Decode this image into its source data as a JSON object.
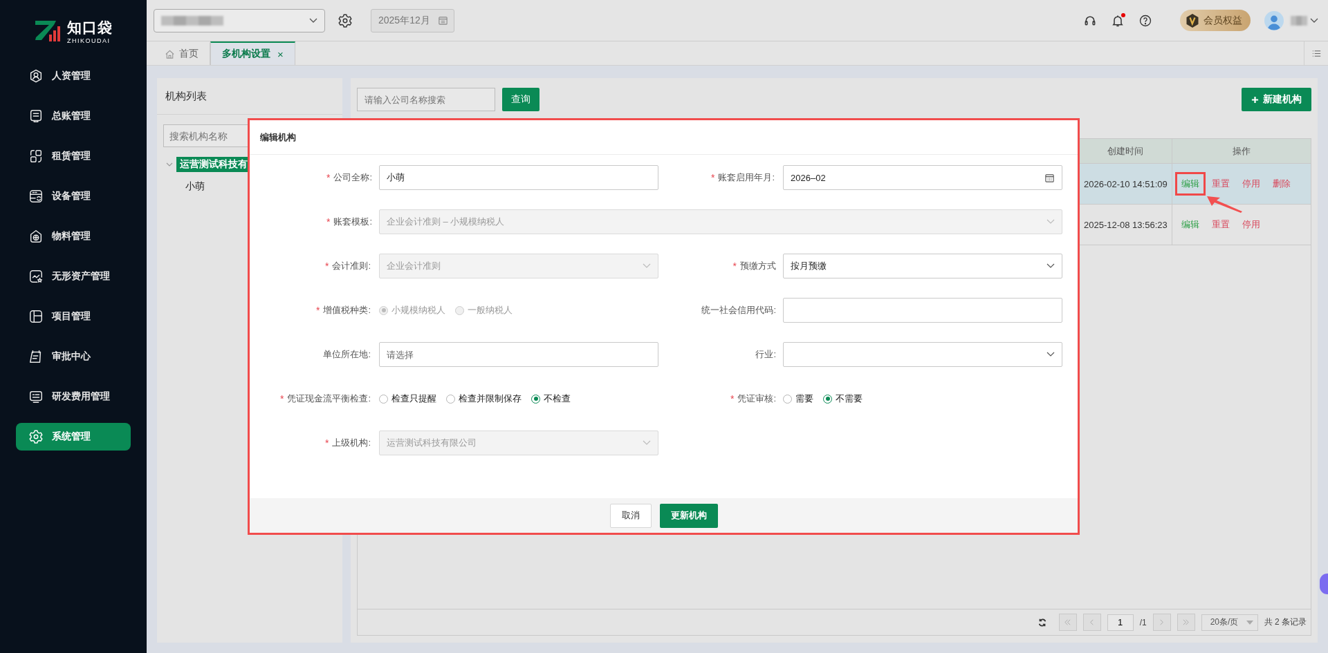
{
  "sidebar": {
    "logo": {
      "name": "知口袋",
      "sub": "ZHIKOUDAI"
    },
    "items": [
      {
        "label": "人资管理",
        "kind": "person",
        "selected": false
      },
      {
        "label": "总账管理",
        "kind": "ledger",
        "selected": false
      },
      {
        "label": "租赁管理",
        "kind": "lease",
        "selected": false
      },
      {
        "label": "设备管理",
        "kind": "device",
        "selected": false
      },
      {
        "label": "物料管理",
        "kind": "material",
        "selected": false
      },
      {
        "label": "无形资产管理",
        "kind": "asset",
        "selected": false
      },
      {
        "label": "项目管理",
        "kind": "project",
        "selected": false
      },
      {
        "label": "审批中心",
        "kind": "approval",
        "selected": false
      },
      {
        "label": "研发费用管理",
        "kind": "rd",
        "selected": false
      },
      {
        "label": "系统管理",
        "kind": "gear",
        "selected": true
      }
    ]
  },
  "topbar": {
    "period": "2025年12月",
    "notification_unread": true,
    "member": "会员权益"
  },
  "tabs": [
    {
      "label": "首页",
      "kind": "home",
      "selected": false
    },
    {
      "label": "多机构设置",
      "kind": "page",
      "selected": true,
      "close": "×"
    }
  ],
  "org_panel": {
    "title": "机构列表",
    "search_placeholder": "搜索机构名称",
    "tree": [
      {
        "label": "运营测试科技有",
        "selected": true,
        "expanded": true,
        "children": [
          {
            "label": "小萌",
            "selected": false
          }
        ]
      }
    ]
  },
  "list_panel": {
    "search_placeholder": "请输入公司名称搜索",
    "query_button": "查询",
    "new_button": "新建机构",
    "table": {
      "columns": [
        "创建时间",
        "操作"
      ],
      "rows": [
        {
          "selected": true,
          "created": "2026-02-10 14:51:09",
          "actions": [
            {
              "label": "编辑",
              "kind": "edit",
              "highlighted": true
            },
            {
              "label": "重置",
              "kind": "danger",
              "highlighted": false
            },
            {
              "label": "停用",
              "kind": "danger",
              "highlighted": false
            },
            {
              "label": "删除",
              "kind": "danger",
              "highlighted": false
            }
          ]
        },
        {
          "selected": false,
          "created": "2025-12-08 13:56:23",
          "actions": [
            {
              "label": "编辑",
              "kind": "edit",
              "highlighted": false
            },
            {
              "label": "重置",
              "kind": "danger",
              "highlighted": false
            },
            {
              "label": "停用",
              "kind": "danger",
              "highlighted": false
            }
          ]
        }
      ]
    },
    "pagination": {
      "page": "1",
      "total_pages": "/1",
      "page_size": "20条/页",
      "summary": "共 2 条记录"
    }
  },
  "modal": {
    "title": "编辑机构",
    "fields": [
      {
        "kind": "text",
        "label": "公司全称:",
        "required_mark": "*",
        "disabled": false,
        "value": "小萌"
      },
      {
        "kind": "date",
        "label": "账套启用年月:",
        "required_mark": "*",
        "disabled": false,
        "value": "2026–02"
      },
      {
        "kind": "select",
        "label": "账套模板:",
        "required_mark": "*",
        "disabled": true,
        "wide": true,
        "value": "企业会计准则 – 小规模纳税人"
      },
      {
        "kind": "select",
        "label": "会计准则:",
        "required_mark": "*",
        "disabled": true,
        "value": "企业会计准则"
      },
      {
        "kind": "select",
        "label": "预缴方式",
        "required_mark": "*",
        "disabled": false,
        "value": "按月预缴"
      },
      {
        "kind": "radio",
        "label": "增值税种类:",
        "required_mark": "*",
        "disabled": true,
        "options": [
          {
            "label": "小规模纳税人",
            "selected": true
          },
          {
            "label": "一般纳税人",
            "selected": false
          }
        ]
      },
      {
        "kind": "text",
        "label": "统一社会信用代码:",
        "disabled": false
      },
      {
        "kind": "text",
        "label": "单位所在地:",
        "disabled": false,
        "placeholder": "请选择"
      },
      {
        "kind": "select",
        "label": "行业:",
        "disabled": false
      },
      {
        "kind": "radio",
        "label": "凭证现金流平衡检查:",
        "required_mark": "*",
        "disabled": false,
        "options": [
          {
            "label": "检查只提醒",
            "selected": false
          },
          {
            "label": "检查并限制保存",
            "selected": false
          },
          {
            "label": "不检查",
            "selected": true
          }
        ]
      },
      {
        "kind": "radio",
        "label": "凭证审核:",
        "required_mark": "*",
        "disabled": false,
        "options": [
          {
            "label": "需要",
            "selected": false
          },
          {
            "label": "不需要",
            "selected": true
          }
        ]
      },
      {
        "kind": "select",
        "label": "上级机构:",
        "required_mark": "*",
        "disabled": true,
        "value": "运营测试科技有限公司"
      }
    ],
    "buttons": [
      {
        "label": "取消",
        "kind": "secondary"
      },
      {
        "label": "更新机构",
        "kind": "primary"
      }
    ]
  }
}
